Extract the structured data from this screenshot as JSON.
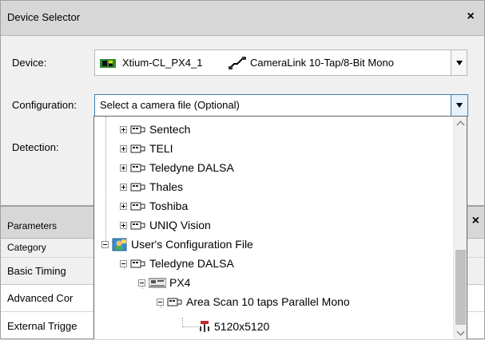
{
  "device_selector": {
    "title": "Device Selector",
    "close": "×",
    "device_label": "Device:",
    "device_board": "Xtium-CL_PX4_1",
    "device_camlink": "CameraLink 10-Tap/8-Bit Mono",
    "configuration_label": "Configuration:",
    "configuration_value": "Select a camera file (Optional)",
    "detection_label": "Detection:"
  },
  "parameters": {
    "title": "Parameters",
    "close": "×",
    "header": "Category",
    "rows": [
      "Basic Timing",
      "Advanced Cor",
      "External Trigge"
    ]
  },
  "tree": {
    "items": [
      {
        "label": "Sentech"
      },
      {
        "label": "TELI"
      },
      {
        "label": "Teledyne DALSA"
      },
      {
        "label": "Thales"
      },
      {
        "label": "Toshiba"
      },
      {
        "label": "UNIQ Vision"
      },
      {
        "label": "User's Configuration File"
      },
      {
        "label": "Teledyne DALSA"
      },
      {
        "label": "PX4"
      },
      {
        "label": "Area Scan 10 taps Parallel Mono"
      },
      {
        "label": "5120x5120"
      }
    ]
  },
  "icons": {
    "camera": "camera-icon",
    "user_config": "user-config-icon",
    "board": "board-icon",
    "camera_file": "camera-file-icon",
    "cable": "cable-icon"
  },
  "colors": {
    "focus_border": "#3c7fb1",
    "panel_bg": "#f0f0f0",
    "titlebar_bg": "#d7d7d7"
  }
}
